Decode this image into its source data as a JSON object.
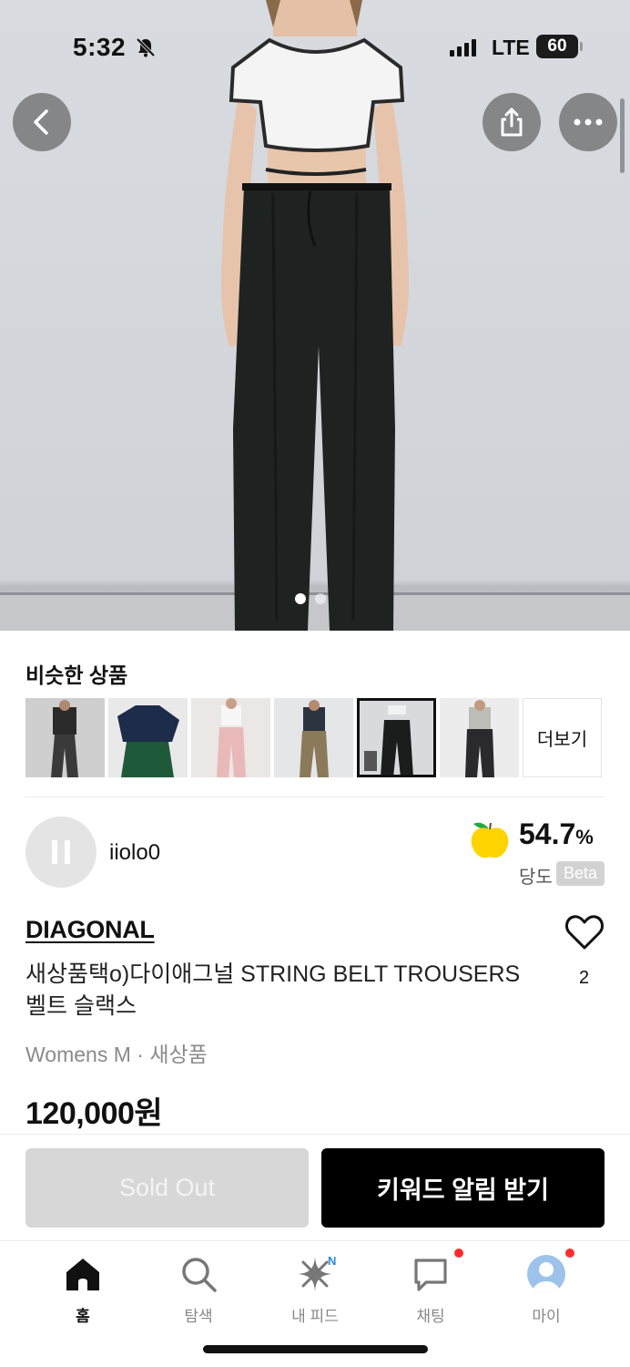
{
  "status_bar": {
    "time": "5:32",
    "network": "LTE",
    "battery": "60"
  },
  "hero": {
    "image_count": 2,
    "active_index": 0
  },
  "similar": {
    "title": "비슷한 상품",
    "more_label": "더보기",
    "thumbs": [
      {
        "selected": false
      },
      {
        "selected": false
      },
      {
        "selected": false
      },
      {
        "selected": false
      },
      {
        "selected": true
      },
      {
        "selected": false
      }
    ]
  },
  "seller": {
    "name": "iiolo0",
    "score_value": "54.7",
    "score_unit": "%",
    "score_label": "당도",
    "beta_label": "Beta"
  },
  "product": {
    "brand": "DIAGONAL",
    "title": "새상품택o)다이애그널 STRING BELT TROUSERS 벨트 슬랙스",
    "meta": "Womens M · 새상품",
    "price": "120,000원",
    "likes": "2"
  },
  "actions": {
    "sold_out_label": "Sold Out",
    "keyword_alert_label": "키워드 알림 받기"
  },
  "tabs": {
    "home": "홈",
    "search": "탐색",
    "feed": "내 피드",
    "feed_badge": "N",
    "chat": "채팅",
    "my": "마이"
  },
  "colors": {
    "accent_black": "#000000",
    "badge_red": "#ff2b2b",
    "badge_blue": "#2a8bd8",
    "score_yellow": "#ffd400"
  }
}
